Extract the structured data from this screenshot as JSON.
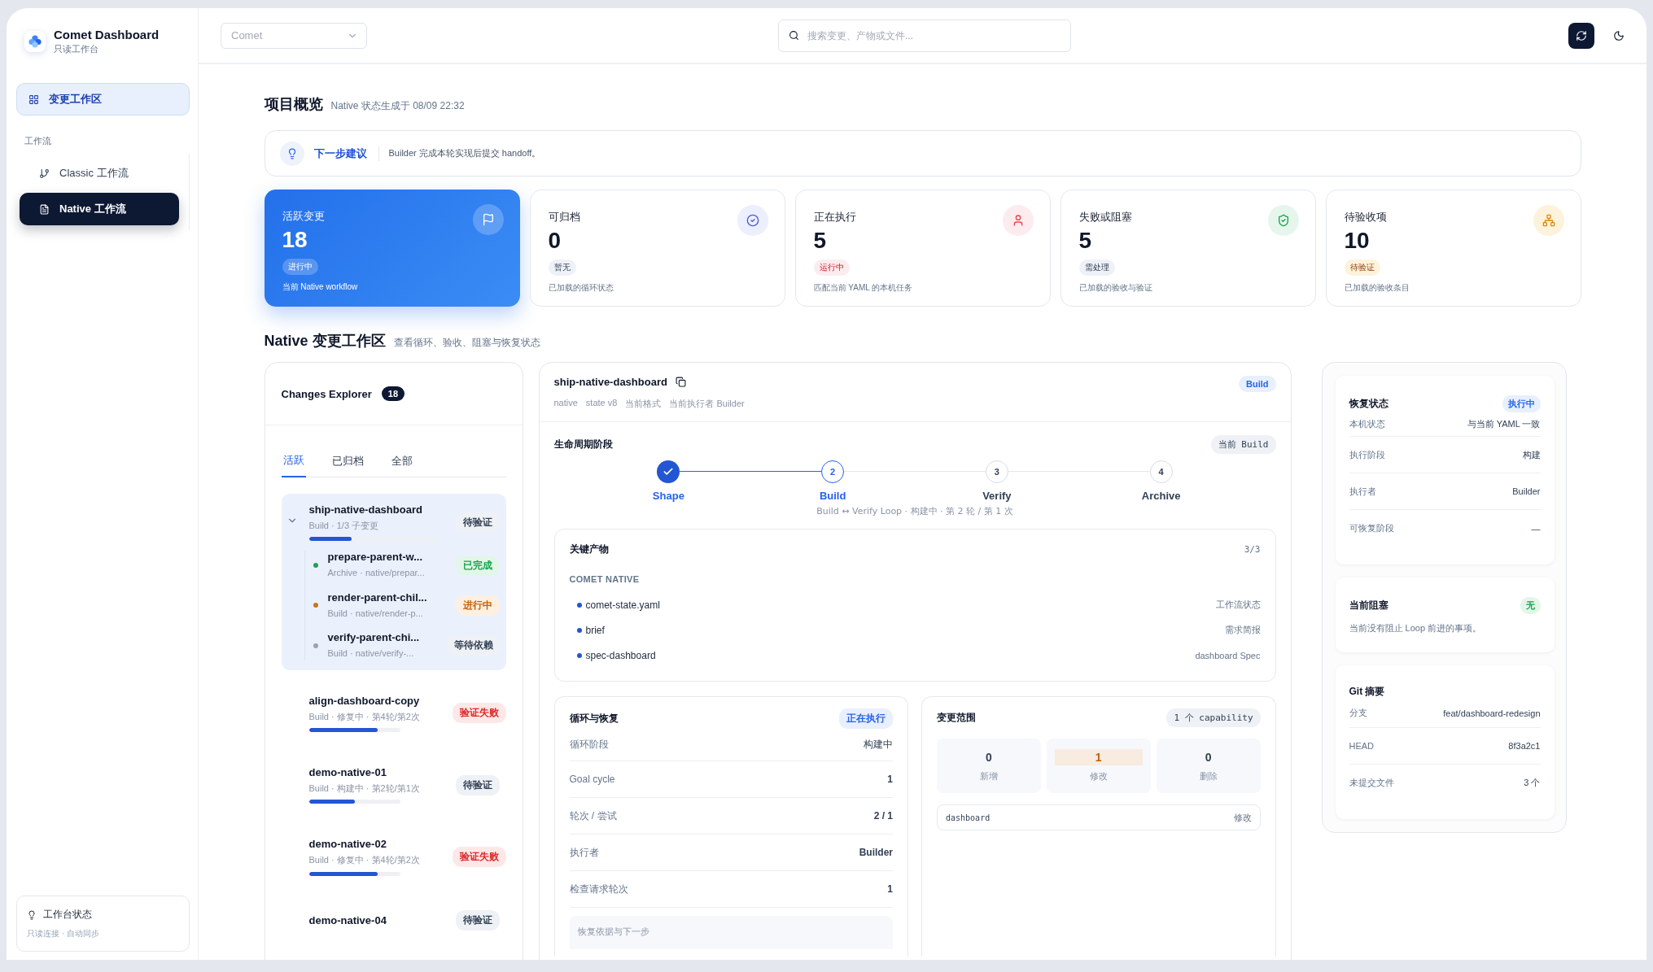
{
  "app": {
    "name": "Comet Dashboard",
    "subtitle": "只读工作台"
  },
  "sidebar": {
    "items": [
      {
        "label": "变更工作区",
        "selected": true
      }
    ],
    "section": "工作流",
    "workflows": [
      {
        "label": "Classic 工作流",
        "selected": false
      },
      {
        "label": "Native 工作流",
        "selected": true
      }
    ],
    "status": {
      "title": "工作台状态",
      "detail": "只读连接 · 自动同步"
    }
  },
  "topbar": {
    "project_select": "Comet",
    "search": {
      "placeholder": "搜索变更、产物或文件..."
    }
  },
  "overview": {
    "title": "项目概览",
    "subtitle": "Native 状态生成于 08/09 22:32",
    "suggestion": {
      "label": "下一步建议",
      "text": "Builder 完成本轮实现后提交 handoff。"
    },
    "cards": [
      {
        "label": "活跃变更",
        "value": "18",
        "badge": "进行中",
        "note": "当前 Native workflow",
        "kind": "blue",
        "selected": true
      },
      {
        "label": "可归档",
        "value": "0",
        "badge": "暂无",
        "note": "已加载的循环状态",
        "kind": "indigo",
        "selected": false
      },
      {
        "label": "正在执行",
        "value": "5",
        "badge": "运行中",
        "note": "匹配当前 YAML 的本机任务",
        "kind": "red",
        "selected": false
      },
      {
        "label": "失败或阻塞",
        "value": "5",
        "badge": "需处理",
        "note": "已加载的验收与验证",
        "kind": "green",
        "selected": false
      },
      {
        "label": "待验收项",
        "value": "10",
        "badge": "待验证",
        "note": "已加载的验收条目",
        "kind": "amber",
        "selected": false
      }
    ]
  },
  "workspace": {
    "title": "Native 变更工作区",
    "subtitle": "查看循环、验收、阻塞与恢复状态"
  },
  "explorer": {
    "title": "Changes Explorer",
    "count": "18",
    "tabs": [
      {
        "label": "活跃",
        "selected": true
      },
      {
        "label": "已归档",
        "selected": false
      },
      {
        "label": "全部",
        "selected": false
      }
    ],
    "changes": [
      {
        "name": "ship-native-dashboard",
        "meta": "Build · 1/3 子变更",
        "status": "待验证",
        "kind": "pending",
        "level": 0.33,
        "selected": true,
        "expanded": true,
        "children": [
          {
            "name": "prepare-parent-w...",
            "meta": "Archive · native/prepar...",
            "status": "已完成",
            "kind": "done",
            "color": "#22a055"
          },
          {
            "name": "render-parent-chil...",
            "meta": "Build · native/render-p...",
            "status": "进行中",
            "kind": "running",
            "color": "#c7761f"
          },
          {
            "name": "verify-parent-chi...",
            "meta": "Build · native/verify-...",
            "status": "等待依赖",
            "kind": "pending",
            "color": "#9ca3af"
          }
        ]
      },
      {
        "name": "align-dashboard-copy",
        "meta": "Build · 修复中 · 第4轮/第2次",
        "status": "验证失败",
        "kind": "failed",
        "level": 0.75,
        "selected": false
      },
      {
        "name": "demo-native-01",
        "meta": "Build · 构建中 · 第2轮/第1次",
        "status": "待验证",
        "kind": "pending",
        "level": 0.5,
        "selected": false
      },
      {
        "name": "demo-native-02",
        "meta": "Build · 修复中 · 第4轮/第2次",
        "status": "验证失败",
        "kind": "failed",
        "level": 0.75,
        "selected": false
      },
      {
        "name": "demo-native-04",
        "status": "待验证",
        "kind": "pending",
        "selected": false
      }
    ]
  },
  "detail": {
    "title": "ship-native-dashboard",
    "phase": "Build",
    "tags": [
      "native",
      "state v8",
      "当前格式",
      "当前执行者 Builder"
    ],
    "lifecycle": {
      "title": "生命周期阶段",
      "current": "当前 Build",
      "note": "Build ↔ Verify Loop · 构建中 · 第 2 轮 / 第 1 次",
      "stages": [
        {
          "label": "Shape",
          "kind": "done"
        },
        {
          "step": "2",
          "label": "Build",
          "kind": "current"
        },
        {
          "step": "3",
          "label": "Verify",
          "kind": "pending"
        },
        {
          "step": "4",
          "label": "Archive",
          "kind": "pending"
        }
      ]
    },
    "artifacts": {
      "title": "关键产物",
      "count": "3/3",
      "group": "COMET NATIVE",
      "items": [
        {
          "name": "comet-state.yaml",
          "description": "工作流状态"
        },
        {
          "name": "brief",
          "description": "需求简报"
        },
        {
          "name": "spec-dashboard",
          "description": "dashboard Spec"
        }
      ]
    },
    "loop": {
      "title": "循环与恢复",
      "badge": "正在执行",
      "rows": [
        {
          "label": "循环阶段",
          "value": "构建中"
        },
        {
          "label": "Goal cycle",
          "value": "1"
        },
        {
          "label": "轮次 / 尝试",
          "value": "2 / 1"
        },
        {
          "label": "执行者",
          "value": "Builder"
        },
        {
          "label": "检查请求轮次",
          "value": "1"
        }
      ],
      "note_title": "恢复依据与下一步"
    },
    "scope": {
      "title": "变更范围",
      "badge": "1 个 capability",
      "stats": [
        {
          "value": "0",
          "label": "新增",
          "highlighted": false
        },
        {
          "value": "1",
          "label": "修改",
          "highlighted": true
        },
        {
          "value": "0",
          "label": "删除",
          "highlighted": false
        }
      ],
      "items": [
        {
          "name": "dashboard",
          "change": "修改"
        }
      ]
    }
  },
  "side": {
    "recovery": {
      "title": "恢复状态",
      "badge": "执行中",
      "rows": [
        {
          "label": "本机状态",
          "value": "与当前 YAML 一致"
        },
        {
          "label": "执行阶段",
          "value": "构建"
        },
        {
          "label": "执行者",
          "value": "Builder"
        },
        {
          "label": "可恢复阶段",
          "value": "—"
        }
      ]
    },
    "blocker": {
      "title": "当前阻塞",
      "badge": "无",
      "text": "当前没有阻止 Loop 前进的事项。"
    },
    "git": {
      "title": "Git 摘要",
      "rows": [
        {
          "label": "分支",
          "value": "feat/dashboard-redesign"
        },
        {
          "label": "HEAD",
          "value": "8f3a2c1"
        },
        {
          "label": "未提交文件",
          "value": "3 个"
        }
      ]
    }
  }
}
